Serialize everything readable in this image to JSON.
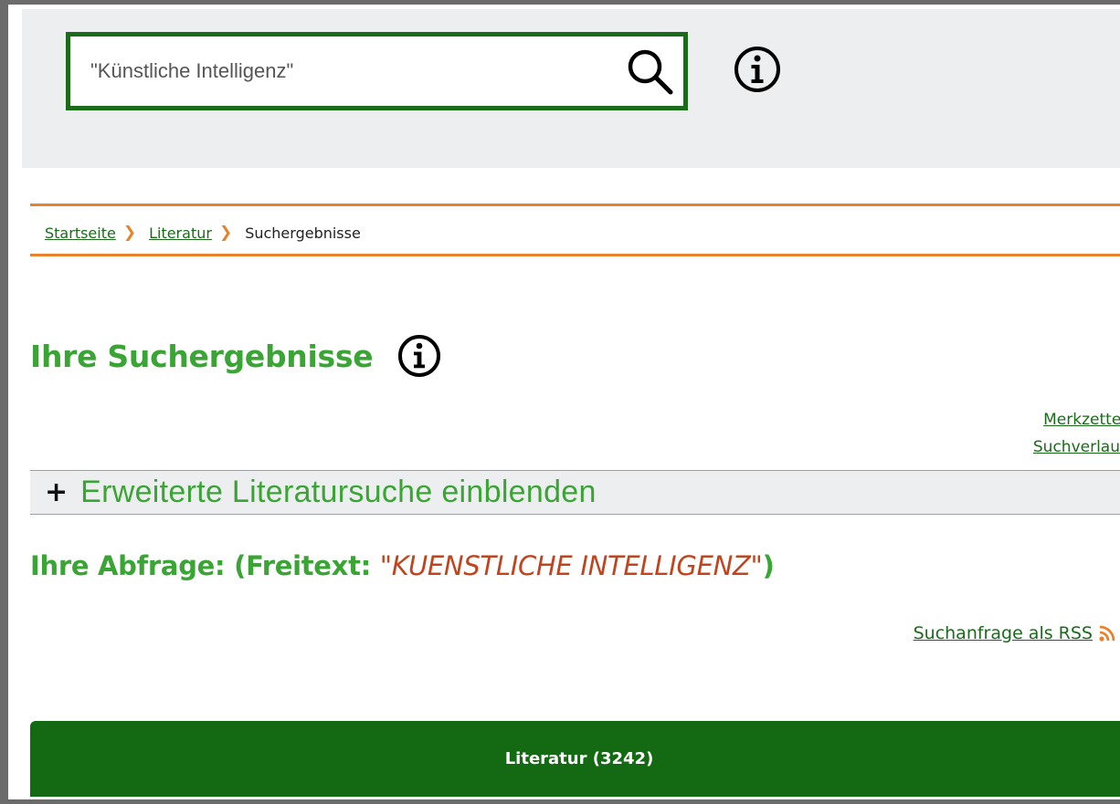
{
  "search": {
    "placeholder": "\"Künstliche Intelligenz\"",
    "value": ""
  },
  "breadcrumb": {
    "items": [
      {
        "label": "Startseite"
      },
      {
        "label": "Literatur"
      }
    ],
    "current": "Suchergebnisse"
  },
  "page": {
    "title": "Ihre Suchergebnisse"
  },
  "side_links": {
    "merkzettel": "Merkzettel",
    "suchverlauf": "Suchverlauf"
  },
  "advanced_search": {
    "toggle_symbol": "+",
    "label": "Erweiterte Literatursuche einblenden"
  },
  "query": {
    "prefix": "Ihre Abfrage: (Freitext: ",
    "term": "\"KUENSTLICHE INTELLIGENZ\"",
    "suffix": ")"
  },
  "rss": {
    "label": "Suchanfrage als RSS"
  },
  "result_tab": {
    "label": "Literatur (3242)"
  },
  "colors": {
    "brand_green": "#1b6b1b",
    "heading_green": "#3aa535",
    "accent_orange": "#e8822c",
    "query_term_red": "#c0451e",
    "tab_green": "#136a13"
  }
}
